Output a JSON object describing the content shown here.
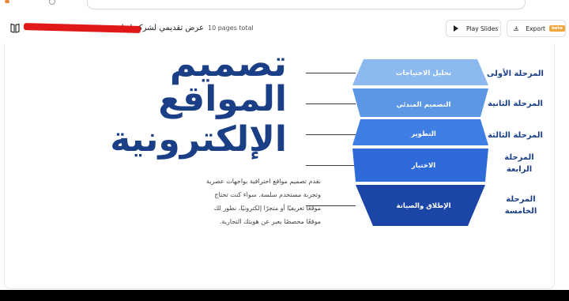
{
  "header": {
    "title": "عرض تقديمي لشركة إبداعية",
    "pages": "10 pages total",
    "play_label": "Play Slides",
    "export_label": "Export",
    "beta_label": "beta"
  },
  "slide": {
    "big_title": [
      "تصميم",
      "المواقع",
      "الإلكترونية"
    ],
    "description": "نقدم تصميم مواقع احترافية بواجهات عصرية وتجربة مستخدم سلسة. سواء كنت تحتاج موقعًا تعريفيًا أو متجرًا إلكترونيًا، نطور لك موقعًا مخصصًا يعبر عن هويتك التجارية.",
    "funnel": [
      {
        "label": "تحليل الاحتياجات",
        "color": "#8cb9f0"
      },
      {
        "label": "التصميم المبدئي",
        "color": "#5c97e6"
      },
      {
        "label": "التطوير",
        "color": "#3f7fe4"
      },
      {
        "label": "الاختبار",
        "color": "#2f6bd8"
      },
      {
        "label": "الإطلاق والصيانة",
        "color": "#1c45a8"
      }
    ],
    "stages": [
      "المرحلة الأولى",
      "المرحلة الثانية",
      "المرحلة الثالثة",
      "المرحلة الرابعة",
      "المرحلة الخامسة"
    ]
  }
}
